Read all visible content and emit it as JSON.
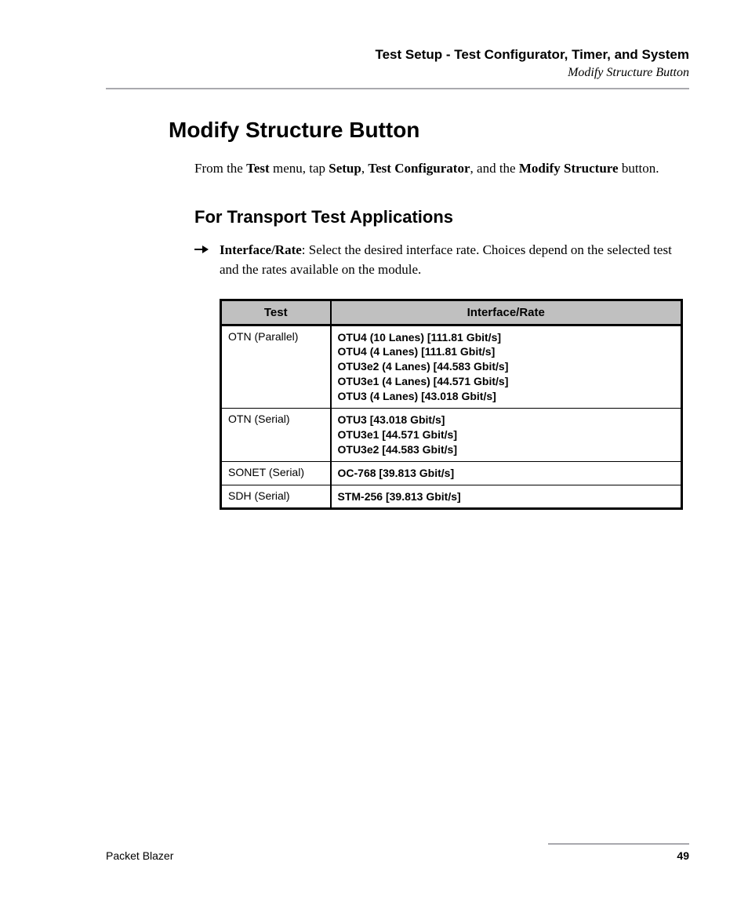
{
  "header": {
    "chapter": "Test Setup - Test Configurator, Timer, and System",
    "subsection": "Modify Structure Button"
  },
  "main_heading": "Modify Structure Button",
  "intro": {
    "p1_a": "From the ",
    "p1_b": "Test",
    "p1_c": " menu, tap ",
    "p1_d": "Setup",
    "p1_e": ", ",
    "p1_f": "Test Configurator",
    "p1_g": ", and the ",
    "p1_h": "Modify Structure",
    "p1_i": " button."
  },
  "sub_heading": "For Transport Test Applications",
  "bullet": {
    "label": "Interface/Rate",
    "text": ": Select the desired interface rate. Choices depend on the selected test and the rates available on the module."
  },
  "table": {
    "headers": {
      "c1": "Test",
      "c2": "Interface/Rate"
    },
    "rows": [
      {
        "test": "OTN (Parallel)",
        "rates": [
          "OTU4 (10 Lanes) [111.81 Gbit/s]",
          "OTU4 (4 Lanes) [111.81 Gbit/s]",
          "OTU3e2 (4 Lanes) [44.583 Gbit/s]",
          "OTU3e1 (4 Lanes) [44.571 Gbit/s]",
          "OTU3 (4 Lanes) [43.018 Gbit/s]"
        ]
      },
      {
        "test": "OTN (Serial)",
        "rates": [
          "OTU3 [43.018 Gbit/s]",
          "OTU3e1 [44.571 Gbit/s]",
          "OTU3e2 [44.583 Gbit/s]"
        ]
      },
      {
        "test": "SONET (Serial)",
        "rates": [
          "OC-768 [39.813 Gbit/s]"
        ]
      },
      {
        "test": "SDH (Serial)",
        "rates": [
          "STM-256 [39.813 Gbit/s]"
        ]
      }
    ]
  },
  "footer": {
    "left": "Packet Blazer",
    "right": "49"
  }
}
